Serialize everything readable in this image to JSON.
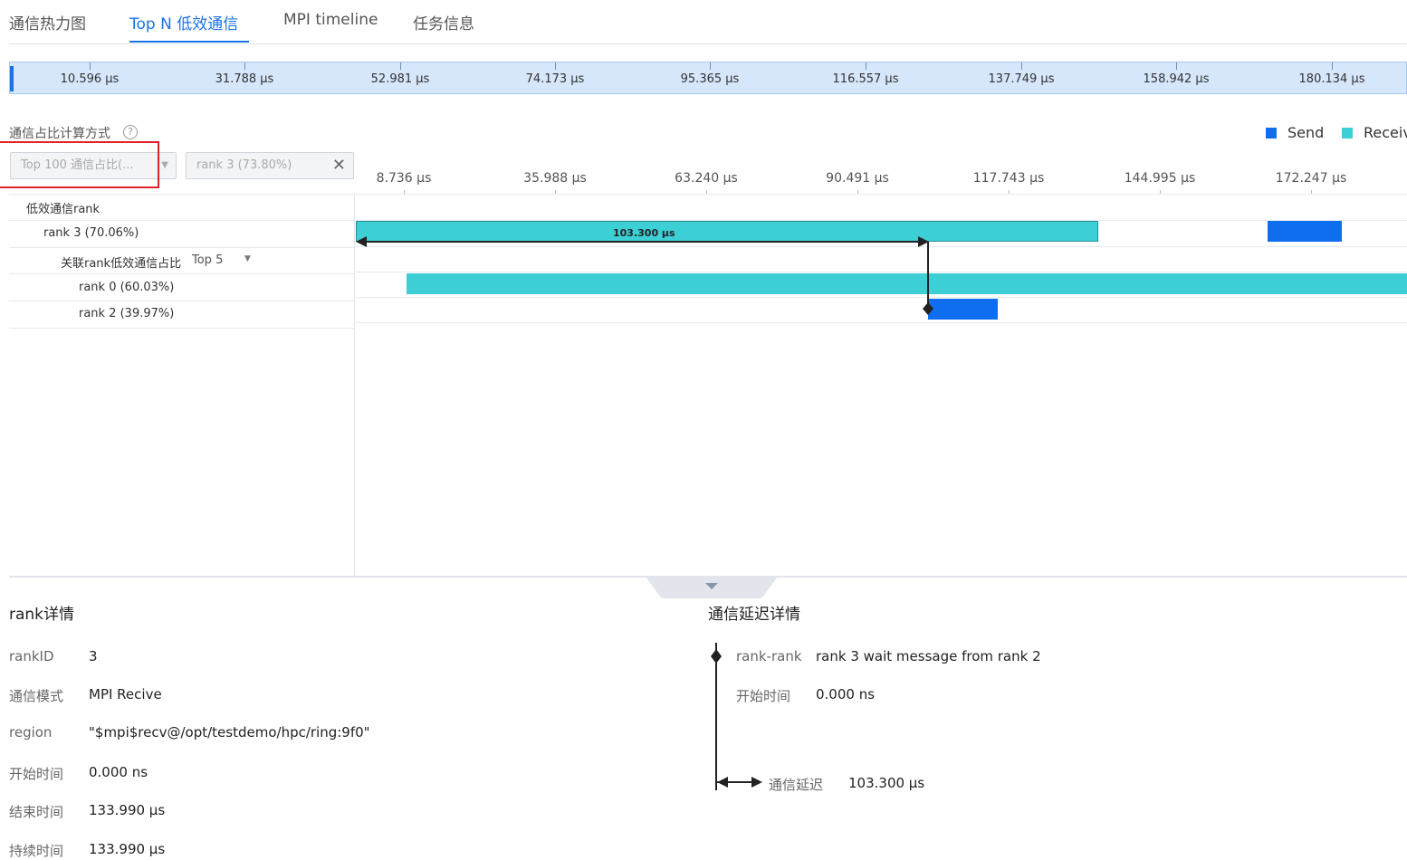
{
  "tabs": [
    "通信热力图",
    "Top N 低效通信",
    "MPI timeline",
    "任务信息"
  ],
  "overview_ticks": [
    "10.596 µs",
    "31.788 µs",
    "52.981 µs",
    "74.173 µs",
    "95.365 µs",
    "116.557 µs",
    "137.749 µs",
    "158.942 µs",
    "180.134 µs"
  ],
  "config": {
    "calc_label": "通信占比计算方式",
    "help_icon": "question-circle-icon",
    "topn_select": "Top 100 通信占比(...",
    "rank_select": "rank 3 (73.80%)"
  },
  "legend": [
    {
      "label": "Send",
      "color": "#0f6ef0"
    },
    {
      "label": "Receiv",
      "color": "#3ccfd6"
    }
  ],
  "axis_ticks": [
    "8.736 µs",
    "35.988 µs",
    "63.240 µs",
    "90.491 µs",
    "117.743 µs",
    "144.995 µs",
    "172.247 µs"
  ],
  "tree": {
    "header": "低效通信rank",
    "main_rank": "rank 3 (70.06%)",
    "related_label": "关联rank低效通信占比",
    "related_select": "Top 5",
    "related": [
      "rank 0 (60.03%)",
      "rank 2 (39.97%)"
    ]
  },
  "delay_marker": "103.300 µs",
  "rank_details": {
    "title": "rank详情",
    "rows": [
      {
        "key": "rankID",
        "value": "3"
      },
      {
        "key": "通信模式",
        "value": "MPI Recive"
      },
      {
        "key": "region",
        "value": "\"$mpi$recv@/opt/testdemo/hpc/ring:9f0\""
      },
      {
        "key": "开始时间",
        "value": "0.000 ns"
      },
      {
        "key": "结束时间",
        "value": "133.990 µs"
      },
      {
        "key": "持续时间",
        "value": "133.990 µs"
      }
    ]
  },
  "delay_details": {
    "title": "通信延迟详情",
    "rank_rank_key": "rank-rank",
    "rank_rank_value": "rank 3 wait message from rank 2",
    "start_key": "开始时间",
    "start_value": "0.000 ns",
    "delay_key": "通信延迟",
    "delay_value": "103.300 µs"
  },
  "colors": {
    "accent": "#1a73e8",
    "send": "#0f6ef0",
    "receive": "#3ccfd6",
    "highlight": "#e0202a"
  }
}
